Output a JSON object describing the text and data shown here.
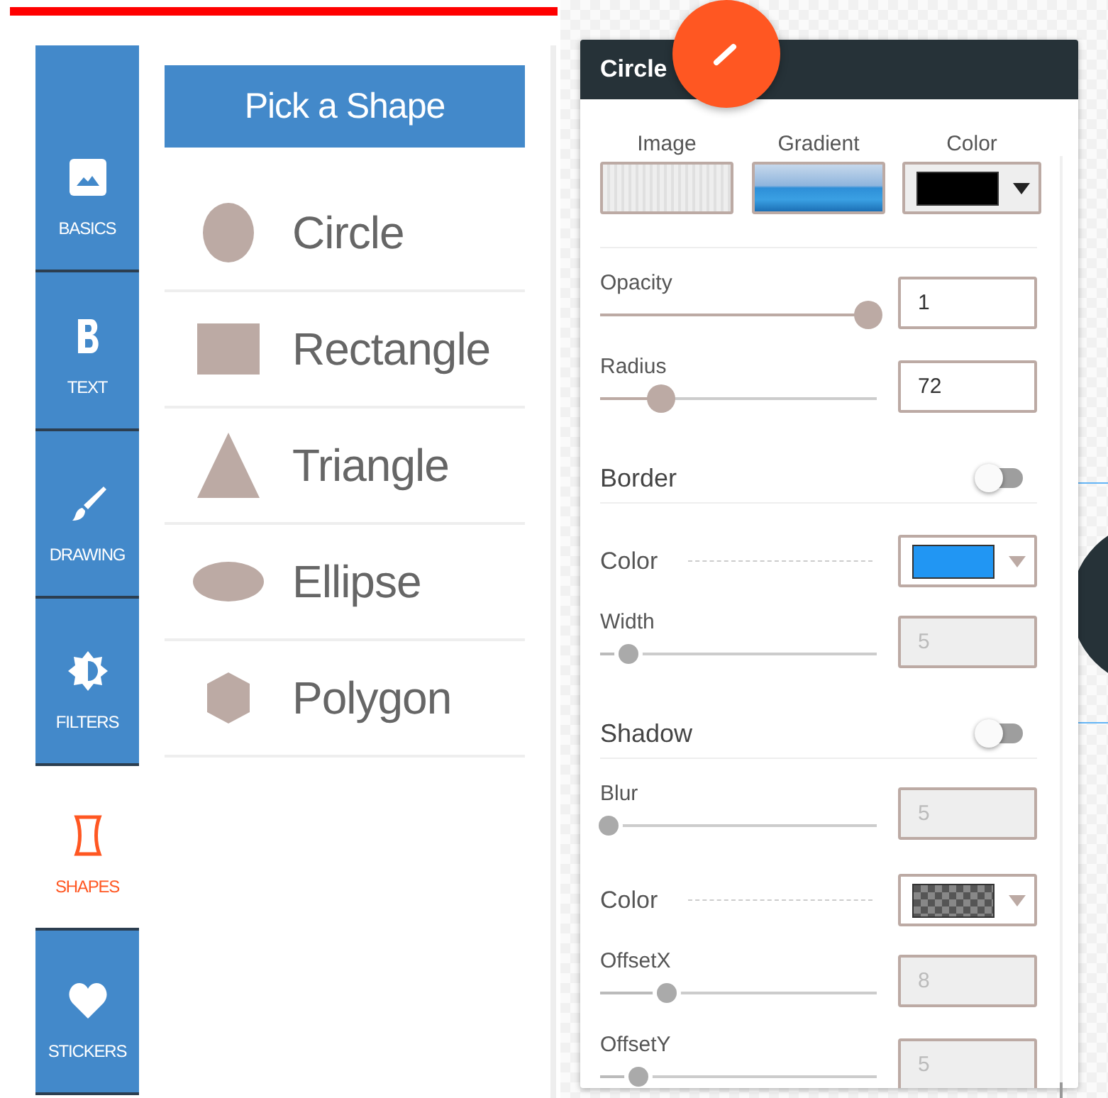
{
  "tool_tabs": [
    {
      "label": "BASICS",
      "kind": "image",
      "selected": false
    },
    {
      "label": "TEXT",
      "kind": "bold",
      "selected": false
    },
    {
      "label": "DRAWING",
      "kind": "brush",
      "selected": false
    },
    {
      "label": "FILTERS",
      "kind": "brightness",
      "selected": false
    },
    {
      "label": "SHAPES",
      "kind": "shapes",
      "selected": true
    },
    {
      "label": "STICKERS",
      "kind": "heart",
      "selected": false
    }
  ],
  "shape_picker": {
    "title": "Pick a Shape",
    "shapes": [
      {
        "label": "Circle",
        "kind": "circle"
      },
      {
        "label": "Rectangle",
        "kind": "rectangle"
      },
      {
        "label": "Triangle",
        "kind": "triangle"
      },
      {
        "label": "Ellipse",
        "kind": "ellipse"
      },
      {
        "label": "Polygon",
        "kind": "polygon"
      }
    ]
  },
  "properties": {
    "title": "Circle",
    "fill": [
      {
        "label": "Image",
        "kind": "image"
      },
      {
        "label": "Gradient",
        "kind": "gradient"
      },
      {
        "label": "Color",
        "kind": "color",
        "color": "#000000"
      }
    ],
    "rows": [
      {
        "kind": "slider",
        "label": "Opacity",
        "value": "1",
        "level": 0.97,
        "disabled": false
      },
      {
        "kind": "slider",
        "label": "Radius",
        "value": "72",
        "level": 0.22,
        "disabled": false
      },
      {
        "kind": "toggle",
        "label": "Border",
        "on": false
      },
      {
        "kind": "color",
        "label": "Color",
        "color": "#2196f3",
        "checkered": false
      },
      {
        "kind": "slider",
        "label": "Width",
        "value": "5",
        "level": 0.1,
        "disabled": true
      },
      {
        "kind": "toggle",
        "label": "Shadow",
        "on": false
      },
      {
        "kind": "slider",
        "label": "Blur",
        "value": "5",
        "level": 0.03,
        "disabled": true
      },
      {
        "kind": "color",
        "label": "Color",
        "color": "#555555",
        "checkered": true
      },
      {
        "kind": "slider",
        "label": "OffsetX",
        "value": "8",
        "level": 0.24,
        "disabled": true
      },
      {
        "kind": "slider",
        "label": "OffsetY",
        "value": "5",
        "level": 0.14,
        "disabled": true
      }
    ]
  }
}
